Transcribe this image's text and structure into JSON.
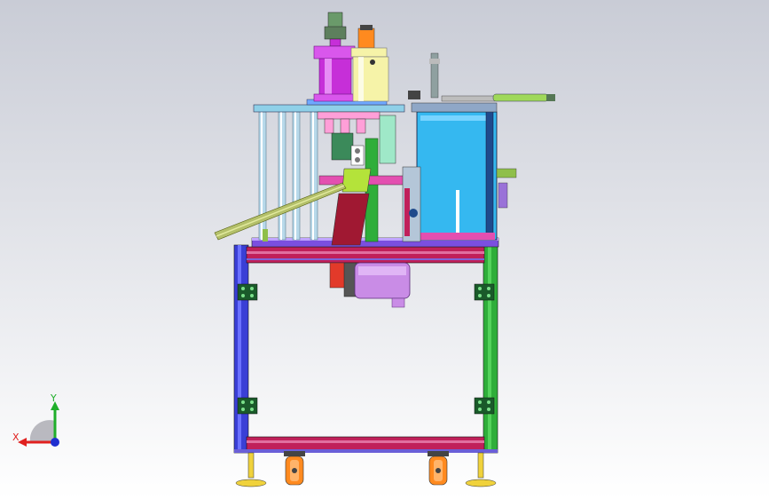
{
  "viewport": {
    "background_top": "#c9ccd6",
    "background_bottom": "#ffffff"
  },
  "model": {
    "name": "",
    "colors": {
      "frame_blue": "#3a3fd6",
      "frame_green": "#2fae3a",
      "rail_magenta": "#c0205a",
      "cabinet_cyan": "#35b8f0",
      "cylinder_purple": "#c62fd8",
      "cylinder_yellow": "#f6f3a8",
      "motor_violet": "#c98ce6",
      "chute_olive": "#b4c06a",
      "caster_orange": "#ff8a1f",
      "foot_yellow": "#f0d23c"
    }
  },
  "triad": {
    "x_label": "X",
    "y_label": "Y",
    "x_color": "#e0201f",
    "y_color": "#1fae2a",
    "z_color": "#1f2fd0"
  }
}
